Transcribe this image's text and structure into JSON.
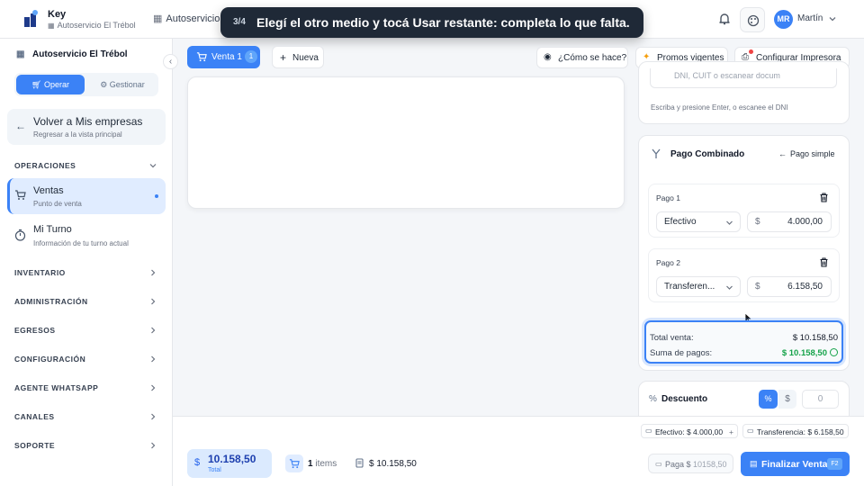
{
  "brand": {
    "name": "Key",
    "store": "Autoservicio El Trébol"
  },
  "breadcrumb": "Autoservicio",
  "tour": {
    "step": "3/4",
    "message": "Elegí el otro medio y tocá Usar restante: completa lo que falta."
  },
  "user": {
    "initials": "MR",
    "name": "Martín"
  },
  "sidebar": {
    "store": "Autoservicio El Trébol",
    "mode_operar": "Operar",
    "mode_gestionar": "Gestionar",
    "back_title": "Volver a Mis empresas",
    "back_sub": "Regresar a la vista principal",
    "operaciones": "OPERACIONES",
    "items": [
      {
        "title": "Ventas",
        "sub": "Punto de venta"
      },
      {
        "title": "Mi Turno",
        "sub": "Información de tu turno actual"
      }
    ],
    "sections": [
      "INVENTARIO",
      "ADMINISTRACIÓN",
      "EGRESOS",
      "CONFIGURACIÓN",
      "AGENTE WHATSAPP",
      "CANALES",
      "SOPORTE"
    ]
  },
  "toolbar": {
    "tab_label": "Venta 1",
    "tab_badge": "1",
    "new_label": "Nueva",
    "help_label": "¿Cómo se hace?",
    "promos_label": "Promos vigentes",
    "printer_label": "Configurar Impresora"
  },
  "customer": {
    "placeholder": "DNI, CUIT o escanear docum",
    "hint": "Escriba y presione Enter, o escanee el DNI"
  },
  "payment": {
    "title": "Pago Combinado",
    "simple_label": "Pago simple",
    "payments": [
      {
        "label": "Pago 1",
        "method": "Efectivo",
        "currency": "$",
        "amount": "4.000,00"
      },
      {
        "label": "Pago 2",
        "method": "Transferen...",
        "currency": "$",
        "amount": "6.158,50"
      }
    ],
    "total_label": "Total venta:",
    "total_value": "$ 10.158,50",
    "sum_label": "Suma de pagos:",
    "sum_value": "$ 10.158,50"
  },
  "discount": {
    "title": "Descuento",
    "pct": "%",
    "dollar": "$",
    "value": "0"
  },
  "footer": {
    "chip_cash": "Efectivo: $ 4.000,00",
    "chip_plus": "+",
    "chip_transfer": "Transferencia: $ 6.158,50",
    "total_currency": "$",
    "total_value": "10.158,50",
    "total_label": "Total",
    "items_count": "1",
    "items_label": "items",
    "subtotal": "$ 10.158,50",
    "paga_label": "Paga $",
    "paga_value": "10158,50",
    "finalize_label": "Finalizar Venta",
    "finalize_key": "F2"
  },
  "colors": {
    "accent": "#3b82f6",
    "success": "#16a34a",
    "tour_bg": "#1f2937"
  }
}
